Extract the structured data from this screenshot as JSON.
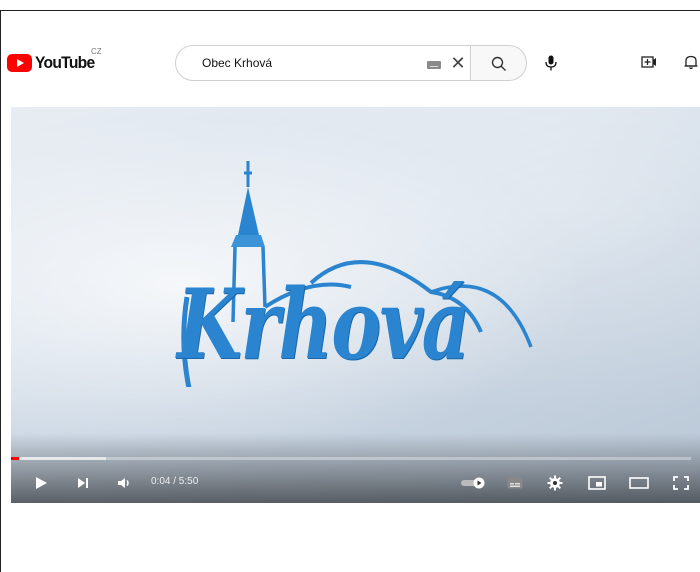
{
  "header": {
    "logo_text": "YouTube",
    "country_code": "CZ",
    "search_value": "Obec Krhová",
    "icons": [
      "keyboard-icon",
      "clear-icon",
      "search-icon",
      "mic-icon",
      "create-icon",
      "bell-icon"
    ]
  },
  "video": {
    "title_art": "Krhová",
    "current_time": "0:04",
    "duration": "5:50",
    "time_display": "0:04 / 5:50",
    "progress_played_fraction": 0.012,
    "progress_loaded_fraction": 0.14
  },
  "colors": {
    "brand_red": "#ff0000",
    "logo_blue": "#2a84cf"
  }
}
